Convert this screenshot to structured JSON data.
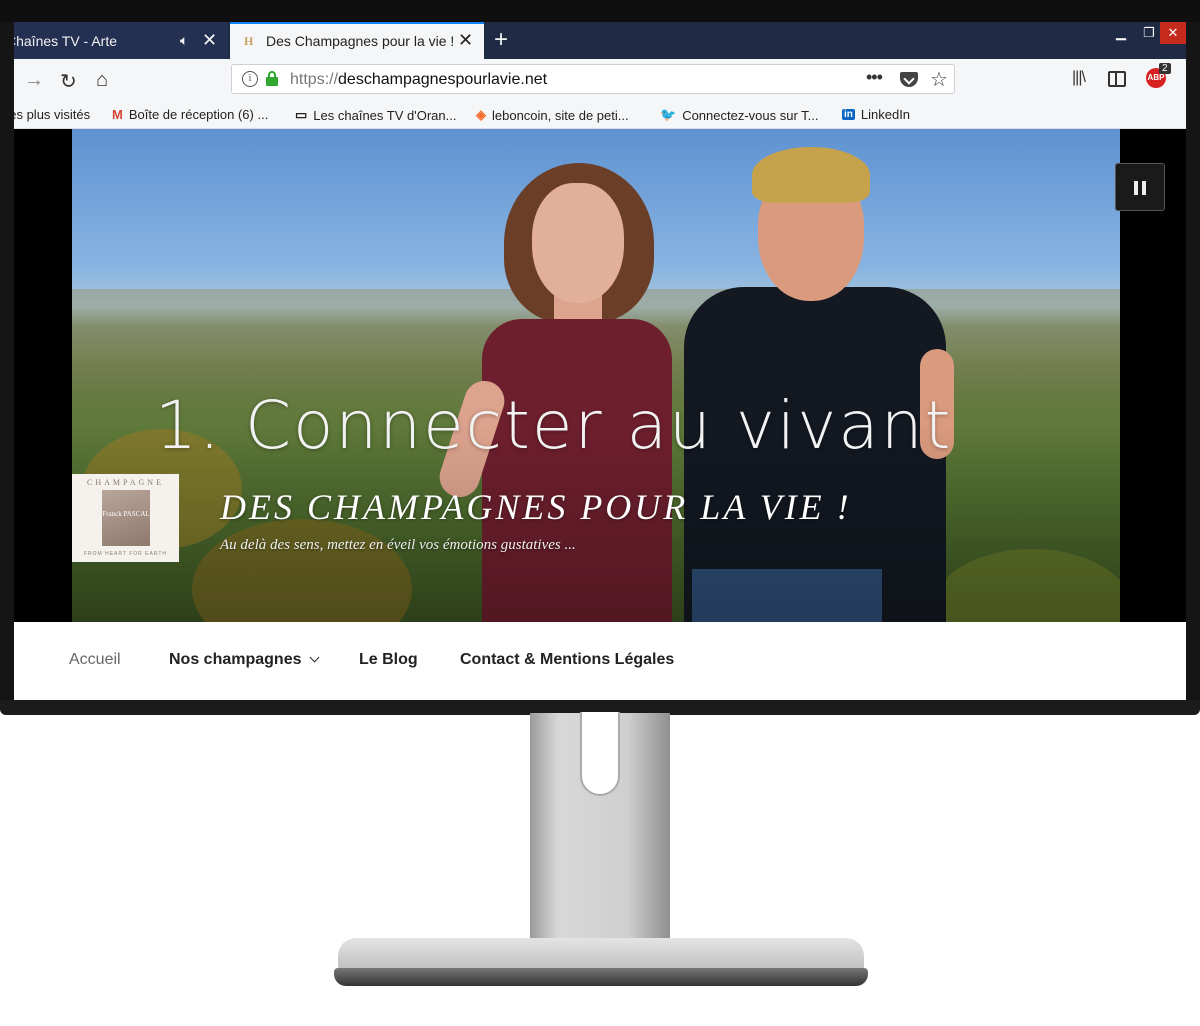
{
  "browser": {
    "tabs": [
      {
        "title": "Chaînes TV - Arte",
        "active": false,
        "audio": true
      },
      {
        "title": "Des Champagnes pour la vie ! -",
        "active": true,
        "favicon": "H"
      }
    ],
    "url": {
      "protocol": "https://",
      "host": "deschampagnespourlavie.net"
    },
    "new_tab_label": "+",
    "page_actions_label": "•••",
    "abp_count": "2",
    "abp_label": "ABP"
  },
  "bookmarks": [
    {
      "label": "Les plus visités",
      "icon": ""
    },
    {
      "label": "Boîte de réception (6) ...",
      "icon": "gmail-icon",
      "glyph": "M",
      "color": "#d44638"
    },
    {
      "label": "Les chaînes TV d'Oran...",
      "icon": "tv-icon",
      "glyph": "▭",
      "color": "#222222"
    },
    {
      "label": "leboncoin, site de peti...",
      "icon": "leboncoin-icon",
      "glyph": "◈",
      "color": "#f56b2a"
    },
    {
      "label": "Connectez-vous sur T...",
      "icon": "twitter-icon",
      "glyph": "🐦",
      "color": "#1da1f2"
    },
    {
      "label": "LinkedIn",
      "icon": "linkedin-icon",
      "glyph": "in",
      "color": "#0a66c2"
    }
  ],
  "hero": {
    "video_caption": "1. Connecter au vivant",
    "site_title": "DES CHAMPAGNES POUR LA VIE !",
    "tagline": "Au delà des sens, mettez en éveil vos émotions gustatives ...",
    "logo": {
      "top": "CHAMPAGNE",
      "name": "Franck PASCAL",
      "bottom": "FROM HEART FOR EARTH"
    }
  },
  "menu": [
    {
      "label": "Accueil",
      "current": true
    },
    {
      "label": "Nos champagnes",
      "dropdown": true
    },
    {
      "label": "Le Blog"
    },
    {
      "label": "Contact & Mentions Légales"
    }
  ],
  "colors": {
    "tab_strip": "#1f2a44",
    "active_tab_accent": "#0a84ff",
    "lock_green": "#2ea82e",
    "dress": "#6e1f2e"
  }
}
